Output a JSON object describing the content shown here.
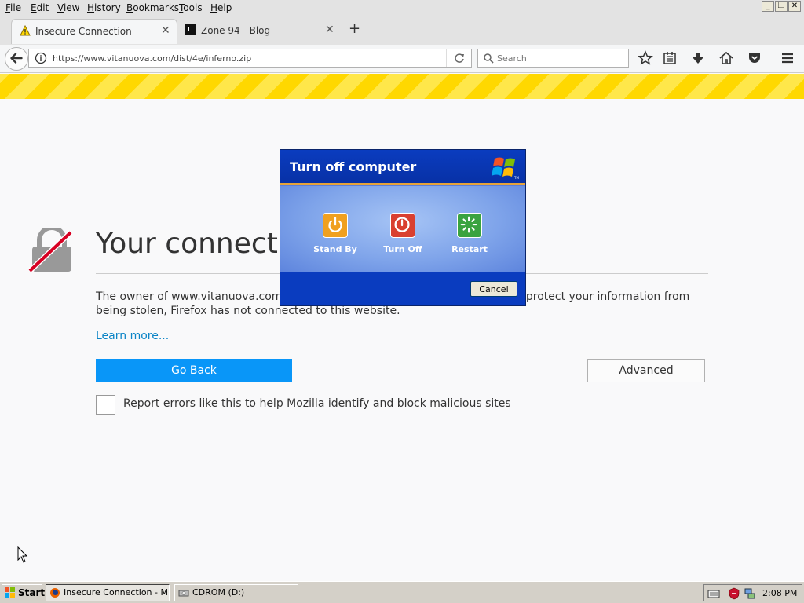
{
  "menu": [
    "File",
    "Edit",
    "View",
    "History",
    "Bookmarks",
    "Tools",
    "Help"
  ],
  "window_controls": [
    "_",
    "❐",
    "✕"
  ],
  "tabs": [
    {
      "label": "Insecure Connection",
      "active": true
    },
    {
      "label": "Zone 94 - Blog",
      "active": false
    }
  ],
  "tab_close": "✕",
  "new_tab": "+",
  "nav": {
    "url": "https://www.vitanuova.com/dist/4e/inferno.zip",
    "search_placeholder": "Search"
  },
  "error_page": {
    "title": "Your connection is not secure",
    "text": "The owner of www.vitanuova.com has configured their website improperly. To protect your information from being stolen, Firefox has not connected to this website.",
    "learn_more": "Learn more...",
    "go_back": "Go Back",
    "advanced": "Advanced",
    "report_label": "Report errors like this to help Mozilla identify and block malicious sites"
  },
  "dialog": {
    "title": "Turn off computer",
    "stand_by": "Stand By",
    "turn_off": "Turn Off",
    "restart": "Restart",
    "cancel": "Cancel",
    "tm": "TM"
  },
  "taskbar": {
    "start": "Start",
    "tasks": [
      "Insecure Connection - M...",
      "CDROM (D:)"
    ],
    "clock": "2:08 PM"
  },
  "colors": {
    "accent": "#0996f8",
    "link": "#0a84c6",
    "warning_stripe": "#ffd800",
    "stand_by": "#f0a020",
    "turn_off": "#d94030",
    "restart": "#3aa340"
  }
}
